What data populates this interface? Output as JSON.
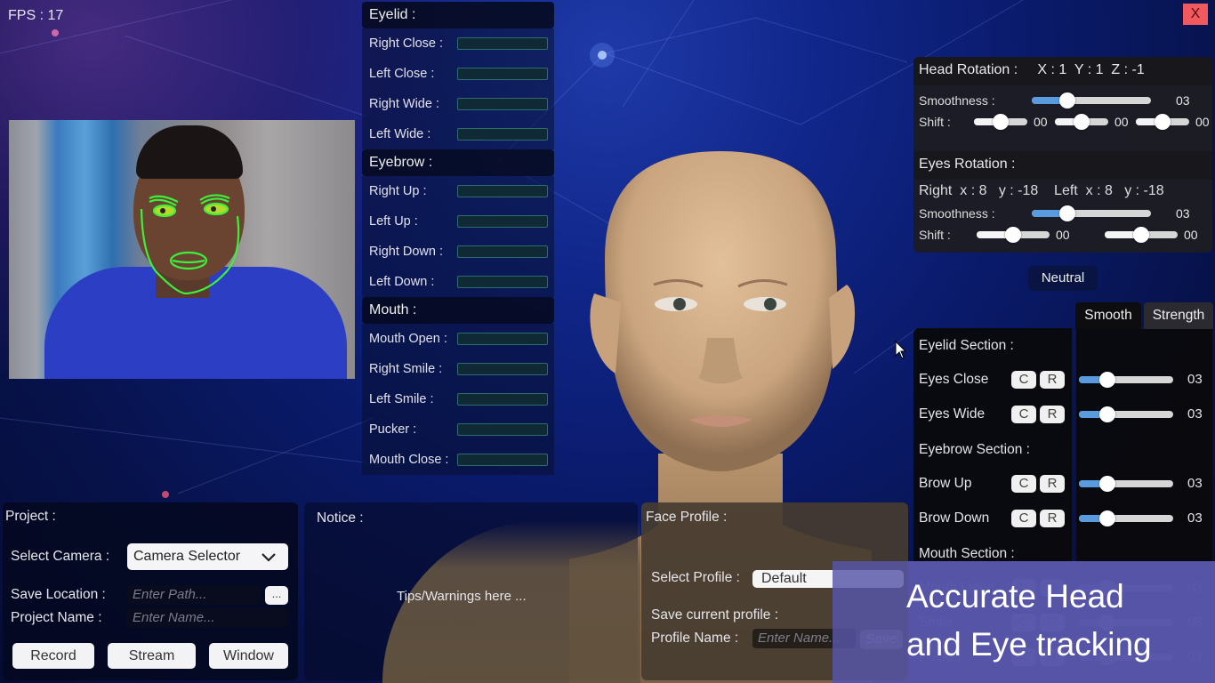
{
  "fps": {
    "label": "FPS : 17"
  },
  "window": {
    "close_label": "X"
  },
  "blendshapes": {
    "groups": [
      {
        "title": "Eyelid :",
        "items": [
          {
            "label": "Right Close :",
            "value": 0
          },
          {
            "label": "Left Close :",
            "value": 0
          },
          {
            "label": "Right Wide :",
            "value": 0
          },
          {
            "label": "Left Wide :",
            "value": 0
          }
        ]
      },
      {
        "title": "Eyebrow :",
        "items": [
          {
            "label": "Right Up :",
            "value": 0
          },
          {
            "label": "Left Up :",
            "value": 0
          },
          {
            "label": "Right Down :",
            "value": 0
          },
          {
            "label": "Left Down :",
            "value": 0
          }
        ]
      },
      {
        "title": "Mouth :",
        "items": [
          {
            "label": "Mouth Open :",
            "value": 0
          },
          {
            "label": "Right Smile :",
            "value": 0
          },
          {
            "label": "Left Smile :",
            "value": 0
          },
          {
            "label": "Pucker :",
            "value": 0
          },
          {
            "label": "Mouth Close :",
            "value": 0
          }
        ]
      }
    ]
  },
  "head_rotation": {
    "title": "Head Rotation :     X : 1  Y : 1  Z : -1",
    "smoothness_label": "Smoothness :",
    "smoothness_value": "03",
    "smoothness_fraction": 0.3,
    "shift_label": "Shift :",
    "shifts": [
      {
        "value": "00",
        "fraction": 0.5
      },
      {
        "value": "00",
        "fraction": 0.5
      },
      {
        "value": "00",
        "fraction": 0.5
      }
    ]
  },
  "eyes_rotation": {
    "title": "Eyes Rotation :",
    "readout": "Right  x : 8   y : -18    Left  x : 8   y : -18",
    "smoothness_label": "Smoothness :",
    "smoothness_value": "03",
    "smoothness_fraction": 0.3,
    "shift_label": "Shift :",
    "shifts": [
      {
        "value": "00",
        "fraction": 0.5
      },
      {
        "value": "00",
        "fraction": 0.5
      }
    ]
  },
  "neutral_button": "Neutral",
  "tabs": [
    {
      "label": "Smooth",
      "active": true
    },
    {
      "label": "Strength",
      "active": false
    }
  ],
  "sections": {
    "eyelid_title": "Eyelid Section :",
    "eyebrow_title": "Eyebrow Section :",
    "mouth_title": "Mouth Section :",
    "c_label": "C",
    "r_label": "R",
    "items": [
      {
        "label": "Eyes Close",
        "value": "03",
        "fraction": 0.3
      },
      {
        "label": "Eyes Wide",
        "value": "03",
        "fraction": 0.3
      },
      {
        "label": "Brow Up",
        "value": "03",
        "fraction": 0.3
      },
      {
        "label": "Brow Down",
        "value": "03",
        "fraction": 0.3
      },
      {
        "label": "Mouth Open",
        "value": "03",
        "fraction": 0.3
      },
      {
        "label": "Smile",
        "value": "03",
        "fraction": 0.3
      },
      {
        "label": "Pucker",
        "value": "03",
        "fraction": 0.3
      }
    ]
  },
  "banner": {
    "line1": "Accurate Head",
    "line2": "and Eye tracking"
  },
  "project": {
    "title": "Project :",
    "camera_label": "Select Camera :",
    "camera_value": "Camera Selector",
    "save_location_label": "Save Location :",
    "save_location_placeholder": "Enter Path...",
    "browse_label": "...",
    "project_name_label": "Project Name :",
    "project_name_placeholder": "Enter Name...",
    "buttons": {
      "record": "Record",
      "stream": "Stream",
      "window": "Window"
    }
  },
  "notice": {
    "title": "Notice :",
    "message": "Tips/Warnings here ..."
  },
  "face_profile": {
    "title": "Face Profile :",
    "select_label": "Select Profile :",
    "select_value": "Default",
    "save_current_label": "Save current profile :",
    "profile_name_label": "Profile Name :",
    "profile_name_placeholder": "Enter Name...",
    "save_button": "Save"
  }
}
